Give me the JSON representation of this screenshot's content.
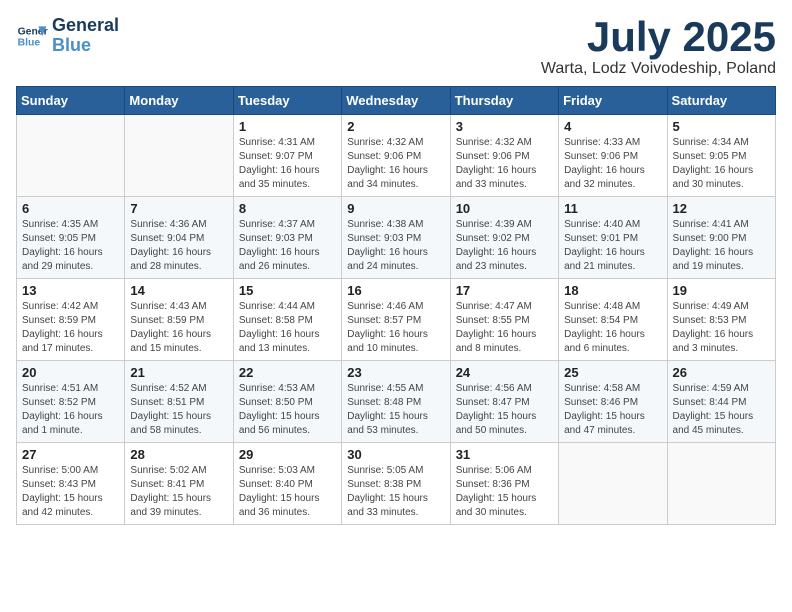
{
  "header": {
    "logo_line1": "General",
    "logo_line2": "Blue",
    "month_title": "July 2025",
    "location": "Warta, Lodz Voivodeship, Poland"
  },
  "weekdays": [
    "Sunday",
    "Monday",
    "Tuesday",
    "Wednesday",
    "Thursday",
    "Friday",
    "Saturday"
  ],
  "weeks": [
    [
      {
        "day": "",
        "content": ""
      },
      {
        "day": "",
        "content": ""
      },
      {
        "day": "1",
        "content": "Sunrise: 4:31 AM\nSunset: 9:07 PM\nDaylight: 16 hours and 35 minutes."
      },
      {
        "day": "2",
        "content": "Sunrise: 4:32 AM\nSunset: 9:06 PM\nDaylight: 16 hours and 34 minutes."
      },
      {
        "day": "3",
        "content": "Sunrise: 4:32 AM\nSunset: 9:06 PM\nDaylight: 16 hours and 33 minutes."
      },
      {
        "day": "4",
        "content": "Sunrise: 4:33 AM\nSunset: 9:06 PM\nDaylight: 16 hours and 32 minutes."
      },
      {
        "day": "5",
        "content": "Sunrise: 4:34 AM\nSunset: 9:05 PM\nDaylight: 16 hours and 30 minutes."
      }
    ],
    [
      {
        "day": "6",
        "content": "Sunrise: 4:35 AM\nSunset: 9:05 PM\nDaylight: 16 hours and 29 minutes."
      },
      {
        "day": "7",
        "content": "Sunrise: 4:36 AM\nSunset: 9:04 PM\nDaylight: 16 hours and 28 minutes."
      },
      {
        "day": "8",
        "content": "Sunrise: 4:37 AM\nSunset: 9:03 PM\nDaylight: 16 hours and 26 minutes."
      },
      {
        "day": "9",
        "content": "Sunrise: 4:38 AM\nSunset: 9:03 PM\nDaylight: 16 hours and 24 minutes."
      },
      {
        "day": "10",
        "content": "Sunrise: 4:39 AM\nSunset: 9:02 PM\nDaylight: 16 hours and 23 minutes."
      },
      {
        "day": "11",
        "content": "Sunrise: 4:40 AM\nSunset: 9:01 PM\nDaylight: 16 hours and 21 minutes."
      },
      {
        "day": "12",
        "content": "Sunrise: 4:41 AM\nSunset: 9:00 PM\nDaylight: 16 hours and 19 minutes."
      }
    ],
    [
      {
        "day": "13",
        "content": "Sunrise: 4:42 AM\nSunset: 8:59 PM\nDaylight: 16 hours and 17 minutes."
      },
      {
        "day": "14",
        "content": "Sunrise: 4:43 AM\nSunset: 8:59 PM\nDaylight: 16 hours and 15 minutes."
      },
      {
        "day": "15",
        "content": "Sunrise: 4:44 AM\nSunset: 8:58 PM\nDaylight: 16 hours and 13 minutes."
      },
      {
        "day": "16",
        "content": "Sunrise: 4:46 AM\nSunset: 8:57 PM\nDaylight: 16 hours and 10 minutes."
      },
      {
        "day": "17",
        "content": "Sunrise: 4:47 AM\nSunset: 8:55 PM\nDaylight: 16 hours and 8 minutes."
      },
      {
        "day": "18",
        "content": "Sunrise: 4:48 AM\nSunset: 8:54 PM\nDaylight: 16 hours and 6 minutes."
      },
      {
        "day": "19",
        "content": "Sunrise: 4:49 AM\nSunset: 8:53 PM\nDaylight: 16 hours and 3 minutes."
      }
    ],
    [
      {
        "day": "20",
        "content": "Sunrise: 4:51 AM\nSunset: 8:52 PM\nDaylight: 16 hours and 1 minute."
      },
      {
        "day": "21",
        "content": "Sunrise: 4:52 AM\nSunset: 8:51 PM\nDaylight: 15 hours and 58 minutes."
      },
      {
        "day": "22",
        "content": "Sunrise: 4:53 AM\nSunset: 8:50 PM\nDaylight: 15 hours and 56 minutes."
      },
      {
        "day": "23",
        "content": "Sunrise: 4:55 AM\nSunset: 8:48 PM\nDaylight: 15 hours and 53 minutes."
      },
      {
        "day": "24",
        "content": "Sunrise: 4:56 AM\nSunset: 8:47 PM\nDaylight: 15 hours and 50 minutes."
      },
      {
        "day": "25",
        "content": "Sunrise: 4:58 AM\nSunset: 8:46 PM\nDaylight: 15 hours and 47 minutes."
      },
      {
        "day": "26",
        "content": "Sunrise: 4:59 AM\nSunset: 8:44 PM\nDaylight: 15 hours and 45 minutes."
      }
    ],
    [
      {
        "day": "27",
        "content": "Sunrise: 5:00 AM\nSunset: 8:43 PM\nDaylight: 15 hours and 42 minutes."
      },
      {
        "day": "28",
        "content": "Sunrise: 5:02 AM\nSunset: 8:41 PM\nDaylight: 15 hours and 39 minutes."
      },
      {
        "day": "29",
        "content": "Sunrise: 5:03 AM\nSunset: 8:40 PM\nDaylight: 15 hours and 36 minutes."
      },
      {
        "day": "30",
        "content": "Sunrise: 5:05 AM\nSunset: 8:38 PM\nDaylight: 15 hours and 33 minutes."
      },
      {
        "day": "31",
        "content": "Sunrise: 5:06 AM\nSunset: 8:36 PM\nDaylight: 15 hours and 30 minutes."
      },
      {
        "day": "",
        "content": ""
      },
      {
        "day": "",
        "content": ""
      }
    ]
  ]
}
